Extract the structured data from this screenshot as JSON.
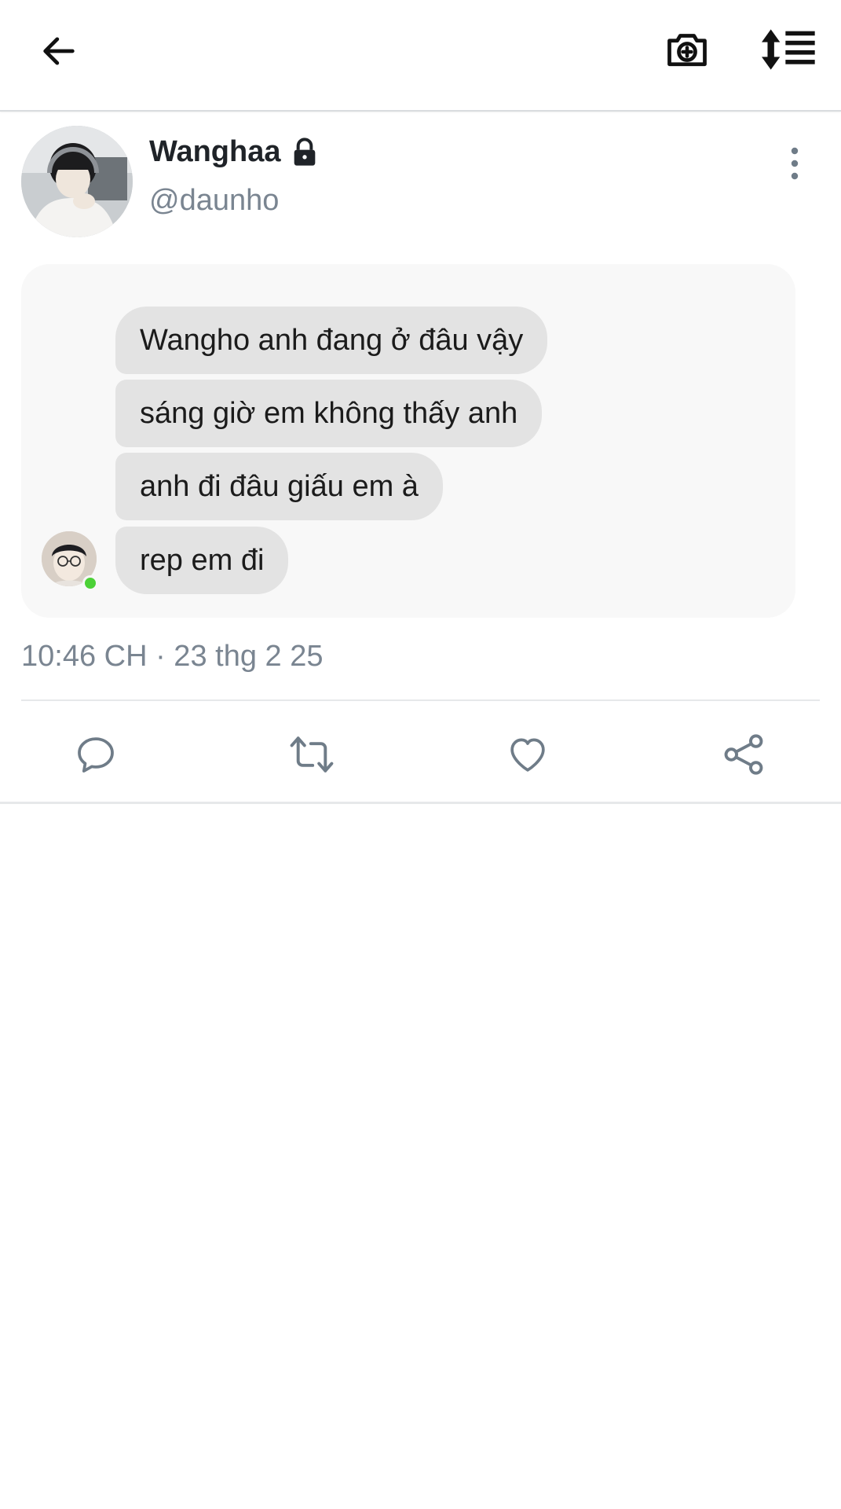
{
  "toolbar": {
    "back_icon": "arrow-left-icon",
    "camera_icon": "camera-add-icon",
    "sort_icon": "sort-list-icon"
  },
  "tweet": {
    "display_name": "Wanghaa",
    "handle": "@daunho",
    "protected": true,
    "timestamp": "10:46 CH · 23 thg 2 25"
  },
  "chat": {
    "messages": [
      "Wangho anh đang ở đâu vậy",
      "sáng giờ em không thấy anh",
      "anh đi đâu giấu em à",
      "rep em đi"
    ],
    "online": true
  },
  "actions": {
    "reply_icon": "comment-icon",
    "retweet_icon": "retweet-icon",
    "like_icon": "heart-icon",
    "share_icon": "share-icon"
  },
  "colors": {
    "secondary_text": "#7a8591",
    "bubble": "#e3e3e3",
    "card": "#f8f8f8",
    "online": "#4cd137"
  }
}
